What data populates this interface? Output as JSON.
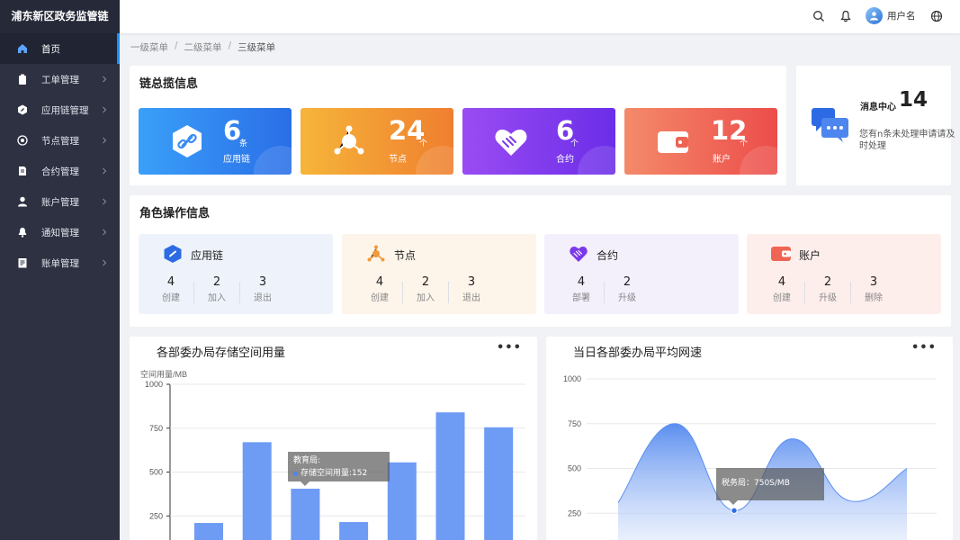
{
  "brand": "浦东新区政务监管链",
  "sidebar": {
    "items": [
      {
        "label": "首页",
        "icon": "home-icon",
        "active": true
      },
      {
        "label": "工单管理",
        "icon": "clipboard-icon"
      },
      {
        "label": "应用链管理",
        "icon": "hexagon-icon"
      },
      {
        "label": "节点管理",
        "icon": "node-icon"
      },
      {
        "label": "合约管理",
        "icon": "contract-icon"
      },
      {
        "label": "账户管理",
        "icon": "user-icon"
      },
      {
        "label": "通知管理",
        "icon": "bell-icon"
      },
      {
        "label": "账单管理",
        "icon": "bill-icon"
      }
    ]
  },
  "header": {
    "username": "用户名"
  },
  "breadcrumb": [
    "一级菜单",
    "二级菜单",
    "三级菜单"
  ],
  "overview": {
    "title": "链总揽信息",
    "cards": [
      {
        "value": "6",
        "unit": "条",
        "label": "应用链",
        "icon": "link-hexagon-icon",
        "gradient": [
          "#3aa0f8",
          "#2a6ee8"
        ]
      },
      {
        "value": "24",
        "unit": "个",
        "label": "节点",
        "icon": "node-network-icon",
        "gradient": [
          "#f6b53a",
          "#ef7f2f"
        ]
      },
      {
        "value": "6",
        "unit": "个",
        "label": "合约",
        "icon": "handshake-icon",
        "gradient": [
          "#9a4cf2",
          "#6b2de8"
        ]
      },
      {
        "value": "12",
        "unit": "个",
        "label": "账户",
        "icon": "wallet-icon",
        "gradient": [
          "#f48a6a",
          "#ec4d4a"
        ]
      }
    ]
  },
  "messages": {
    "title": "消息中心",
    "count": "14",
    "desc": "您有n条未处理申请请及时处理"
  },
  "roles": {
    "title": "角色操作信息",
    "cards": [
      {
        "name": "应用链",
        "bg": "#eef3fb",
        "stats": [
          {
            "v": "4",
            "l": "创建"
          },
          {
            "v": "2",
            "l": "加入"
          },
          {
            "v": "3",
            "l": "退出"
          }
        ]
      },
      {
        "name": "节点",
        "bg": "#fdf4ea",
        "stats": [
          {
            "v": "4",
            "l": "创建"
          },
          {
            "v": "2",
            "l": "加入"
          },
          {
            "v": "3",
            "l": "退出"
          }
        ]
      },
      {
        "name": "合约",
        "bg": "#f3effb",
        "stats": [
          {
            "v": "4",
            "l": "部署"
          },
          {
            "v": "2",
            "l": "升级"
          }
        ]
      },
      {
        "name": "账户",
        "bg": "#fdeeec",
        "stats": [
          {
            "v": "4",
            "l": "创建"
          },
          {
            "v": "2",
            "l": "升级"
          },
          {
            "v": "3",
            "l": "删除"
          }
        ]
      }
    ]
  },
  "chart_data": [
    {
      "type": "bar",
      "title": "各部委办局存储空间用量",
      "ylabel": "空间用量/MB",
      "ylim": [
        0,
        1000
      ],
      "yticks": [
        "1000",
        "750",
        "500",
        "250"
      ],
      "values": [
        210,
        670,
        405,
        215,
        555,
        840,
        755
      ],
      "color": "#6e9bf4",
      "tooltip": {
        "title": "教育局:",
        "label": "存储空间用量:152"
      }
    },
    {
      "type": "area",
      "title": "当日各部委办局平均网速",
      "ylim": [
        0,
        1000
      ],
      "yticks": [
        "1000",
        "750",
        "500",
        "250"
      ],
      "values": [
        310,
        750,
        265,
        665,
        320,
        500
      ],
      "color": "#6e9bf4",
      "tooltip": {
        "label": "税务局：750S/MB"
      }
    }
  ]
}
